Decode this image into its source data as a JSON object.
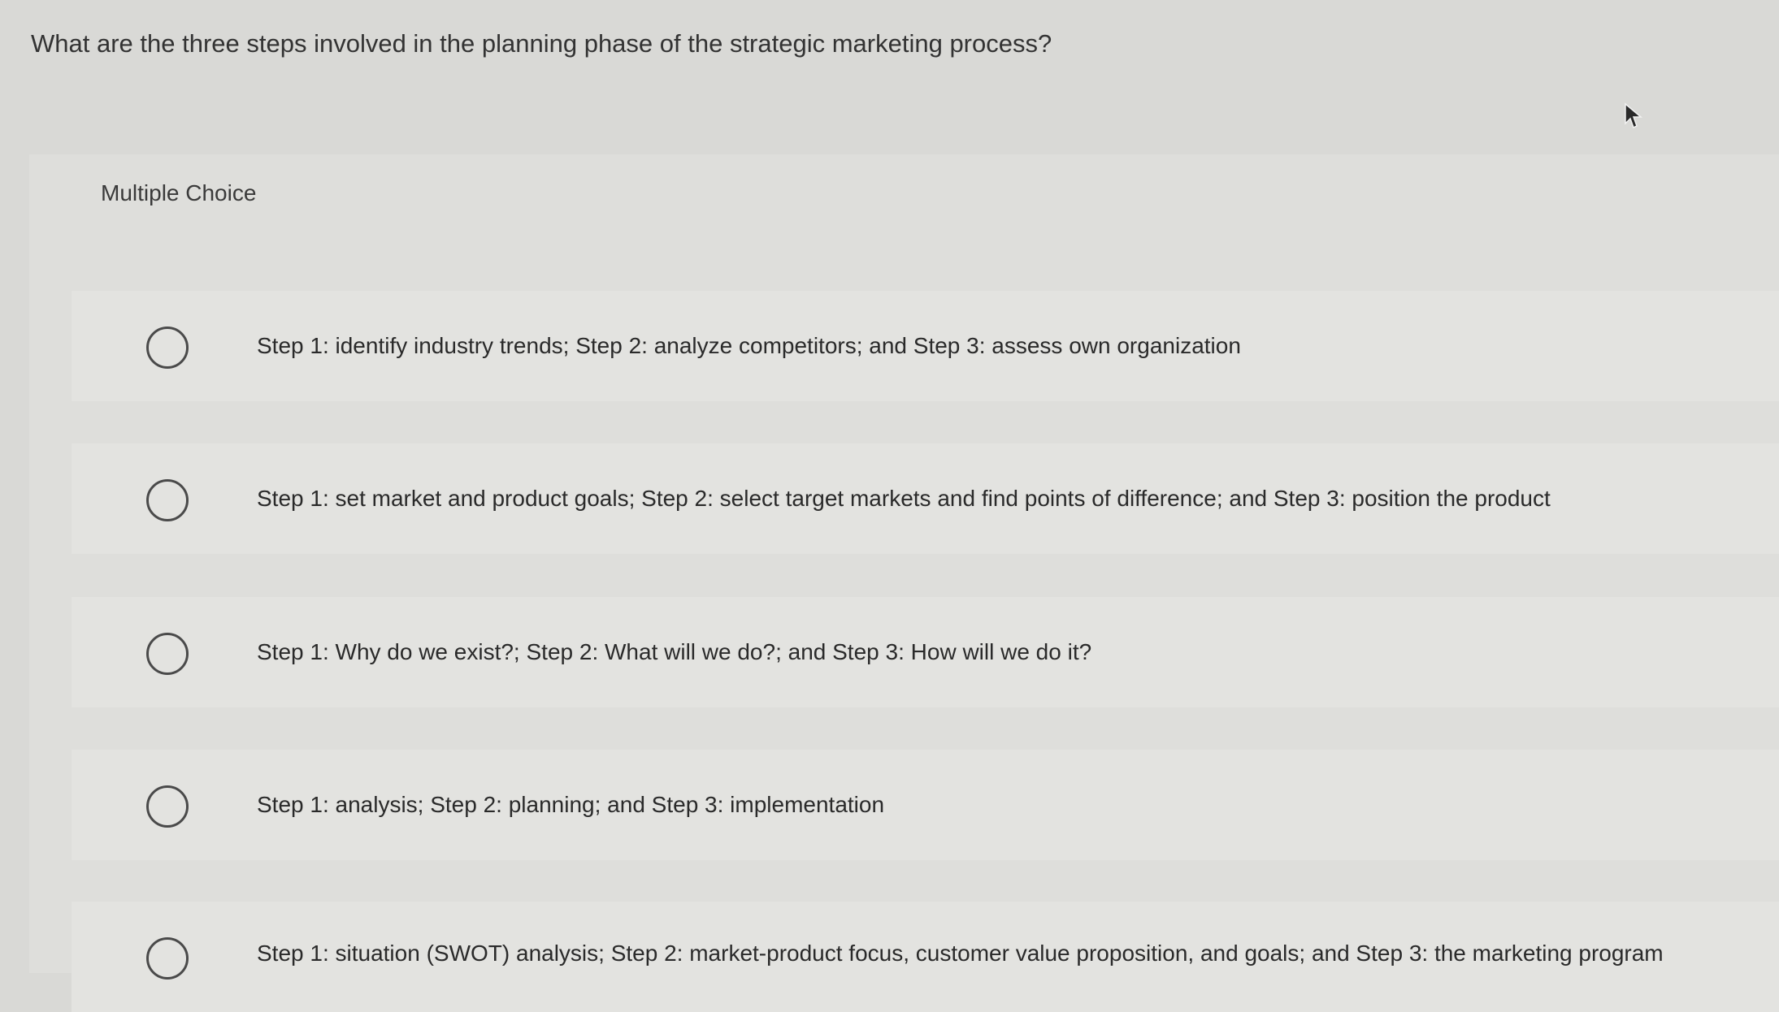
{
  "question": {
    "text": "What are the three steps involved in the planning phase of the strategic marketing process?"
  },
  "question_type": "Multiple Choice",
  "cursor_icon": "arrow-cursor-icon",
  "options": [
    {
      "label": "Step 1: identify industry trends; Step 2: analyze competitors; and Step 3: assess own organization",
      "selected": false
    },
    {
      "label": "Step 1: set market and product goals; Step 2: select target markets and find points of difference; and Step 3: position the product",
      "selected": false
    },
    {
      "label": "Step 1: Why do we exist?; Step 2: What will we do?; and Step 3: How will we do it?",
      "selected": false
    },
    {
      "label": "Step 1: analysis; Step 2: planning; and Step 3: implementation",
      "selected": false
    },
    {
      "label": "Step 1: situation (SWOT) analysis; Step 2: market-product focus, customer value proposition, and goals; and Step 3: the marketing program",
      "selected": false
    }
  ]
}
